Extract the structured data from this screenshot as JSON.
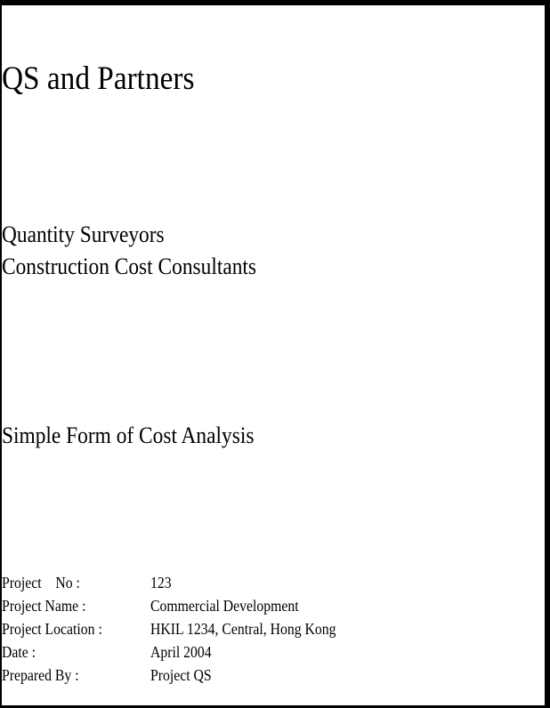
{
  "company": "QS and Partners",
  "services": [
    "Quantity Surveyors",
    "Construction Cost Consultants"
  ],
  "document_title": "Simple Form of Cost Analysis",
  "details": [
    {
      "label": "Project    No :",
      "value": "123"
    },
    {
      "label": "Project Name :",
      "value": "Commercial Development"
    },
    {
      "label": "Project Location :",
      "value": "HKIL 1234, Central, Hong Kong"
    },
    {
      "label": "Date :",
      "value": "April 2004"
    },
    {
      "label": "Prepared By :",
      "value": "Project QS"
    }
  ]
}
